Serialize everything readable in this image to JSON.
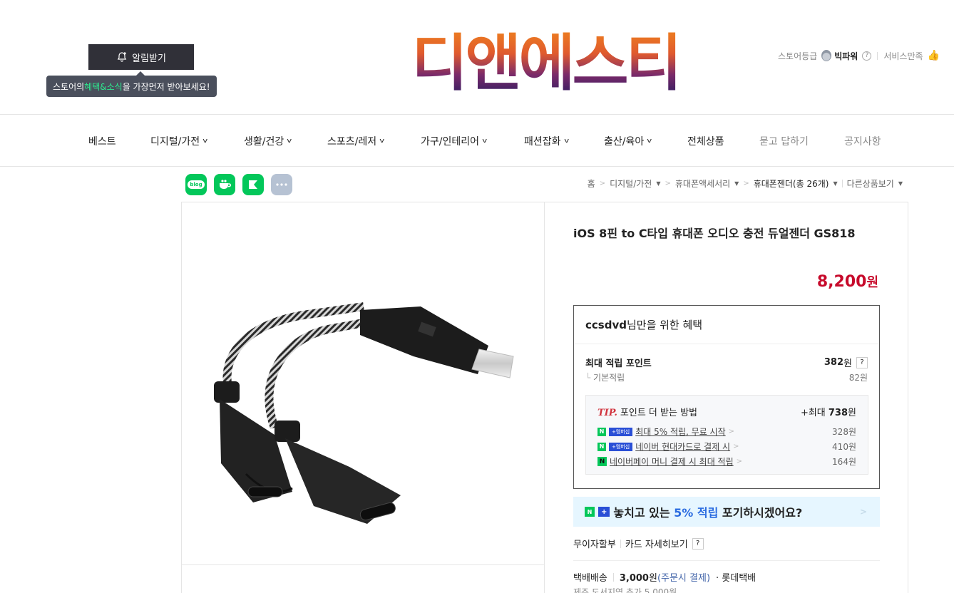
{
  "header": {
    "alarm_label": "알림받기",
    "tooltip_prefix": "스토어의 ",
    "tooltip_highlight": "혜택&소식",
    "tooltip_suffix": "을 가장먼저 받아보세요!",
    "logo_text": "디앤에스티",
    "store_grade_label": "스토어등급",
    "store_grade_value": "빅파워",
    "service_label": "서비스만족"
  },
  "nav": {
    "items": [
      {
        "label": "베스트",
        "dropdown": false
      },
      {
        "label": "디지털/가전",
        "dropdown": true
      },
      {
        "label": "생활/건강",
        "dropdown": true
      },
      {
        "label": "스포츠/레저",
        "dropdown": true
      },
      {
        "label": "가구/인테리어",
        "dropdown": true
      },
      {
        "label": "패션잡화",
        "dropdown": true
      },
      {
        "label": "출산/육아",
        "dropdown": true
      },
      {
        "label": "전체상품",
        "dropdown": false
      },
      {
        "label": "묻고 답하기",
        "dropdown": false
      },
      {
        "label": "공지사항",
        "dropdown": false
      }
    ]
  },
  "share": {
    "blog_label": "blog"
  },
  "breadcrumb": {
    "home": "홈",
    "level1": "디지털/가전",
    "level2": "휴대폰액세서리",
    "current": "휴대폰젠더(총 26개)",
    "other": "다른상품보기"
  },
  "product": {
    "title": "iOS 8핀 to C타입 휴대폰 오디오 충전 듀얼젠더 GS818",
    "price": "8,200",
    "currency": "원"
  },
  "benefit": {
    "user": "ccsdvd",
    "heading_suffix": "님만을 위한 혜택",
    "max_points_label": "최대 적립 포인트",
    "max_points_value": "382",
    "basic_label": "기본적립",
    "basic_value": "82원",
    "won": "원",
    "question": "?",
    "tip_label": "TIP.",
    "tip_title": "포인트 더 받는 방법",
    "tip_max_prefix": "+최대 ",
    "tip_max_value": "738",
    "tip_lines": [
      {
        "badge": "멤버십",
        "text": "최대 5% 적립, 무료 시작",
        "amount": "328원"
      },
      {
        "badge": "멤버십",
        "text": "네이버 현대카드로 결제 시",
        "amount": "410원"
      },
      {
        "badge": "",
        "text": "네이버페이 머니 결제 시 최대 적립",
        "amount": "164원"
      }
    ]
  },
  "banner": {
    "text_before": "놓치고 있는 ",
    "text_highlight": "5% 적립",
    "text_after": " 포기하시겠어요?"
  },
  "payment": {
    "installment": "무이자할부",
    "card_detail": "카드 자세히보기",
    "question": "?"
  },
  "shipping": {
    "label": "택배배송",
    "fee": "3,000",
    "fee_unit": "원",
    "condition": "(주문시 결제)",
    "carrier": "· 롯데택배",
    "extra": "제주 도서지역 추가 5,000원"
  },
  "colors": {
    "price_red": "#c70a2b",
    "naver_green": "#03c75a",
    "banner_bg": "#e6f6ff",
    "highlight_blue": "#2a6be0"
  }
}
